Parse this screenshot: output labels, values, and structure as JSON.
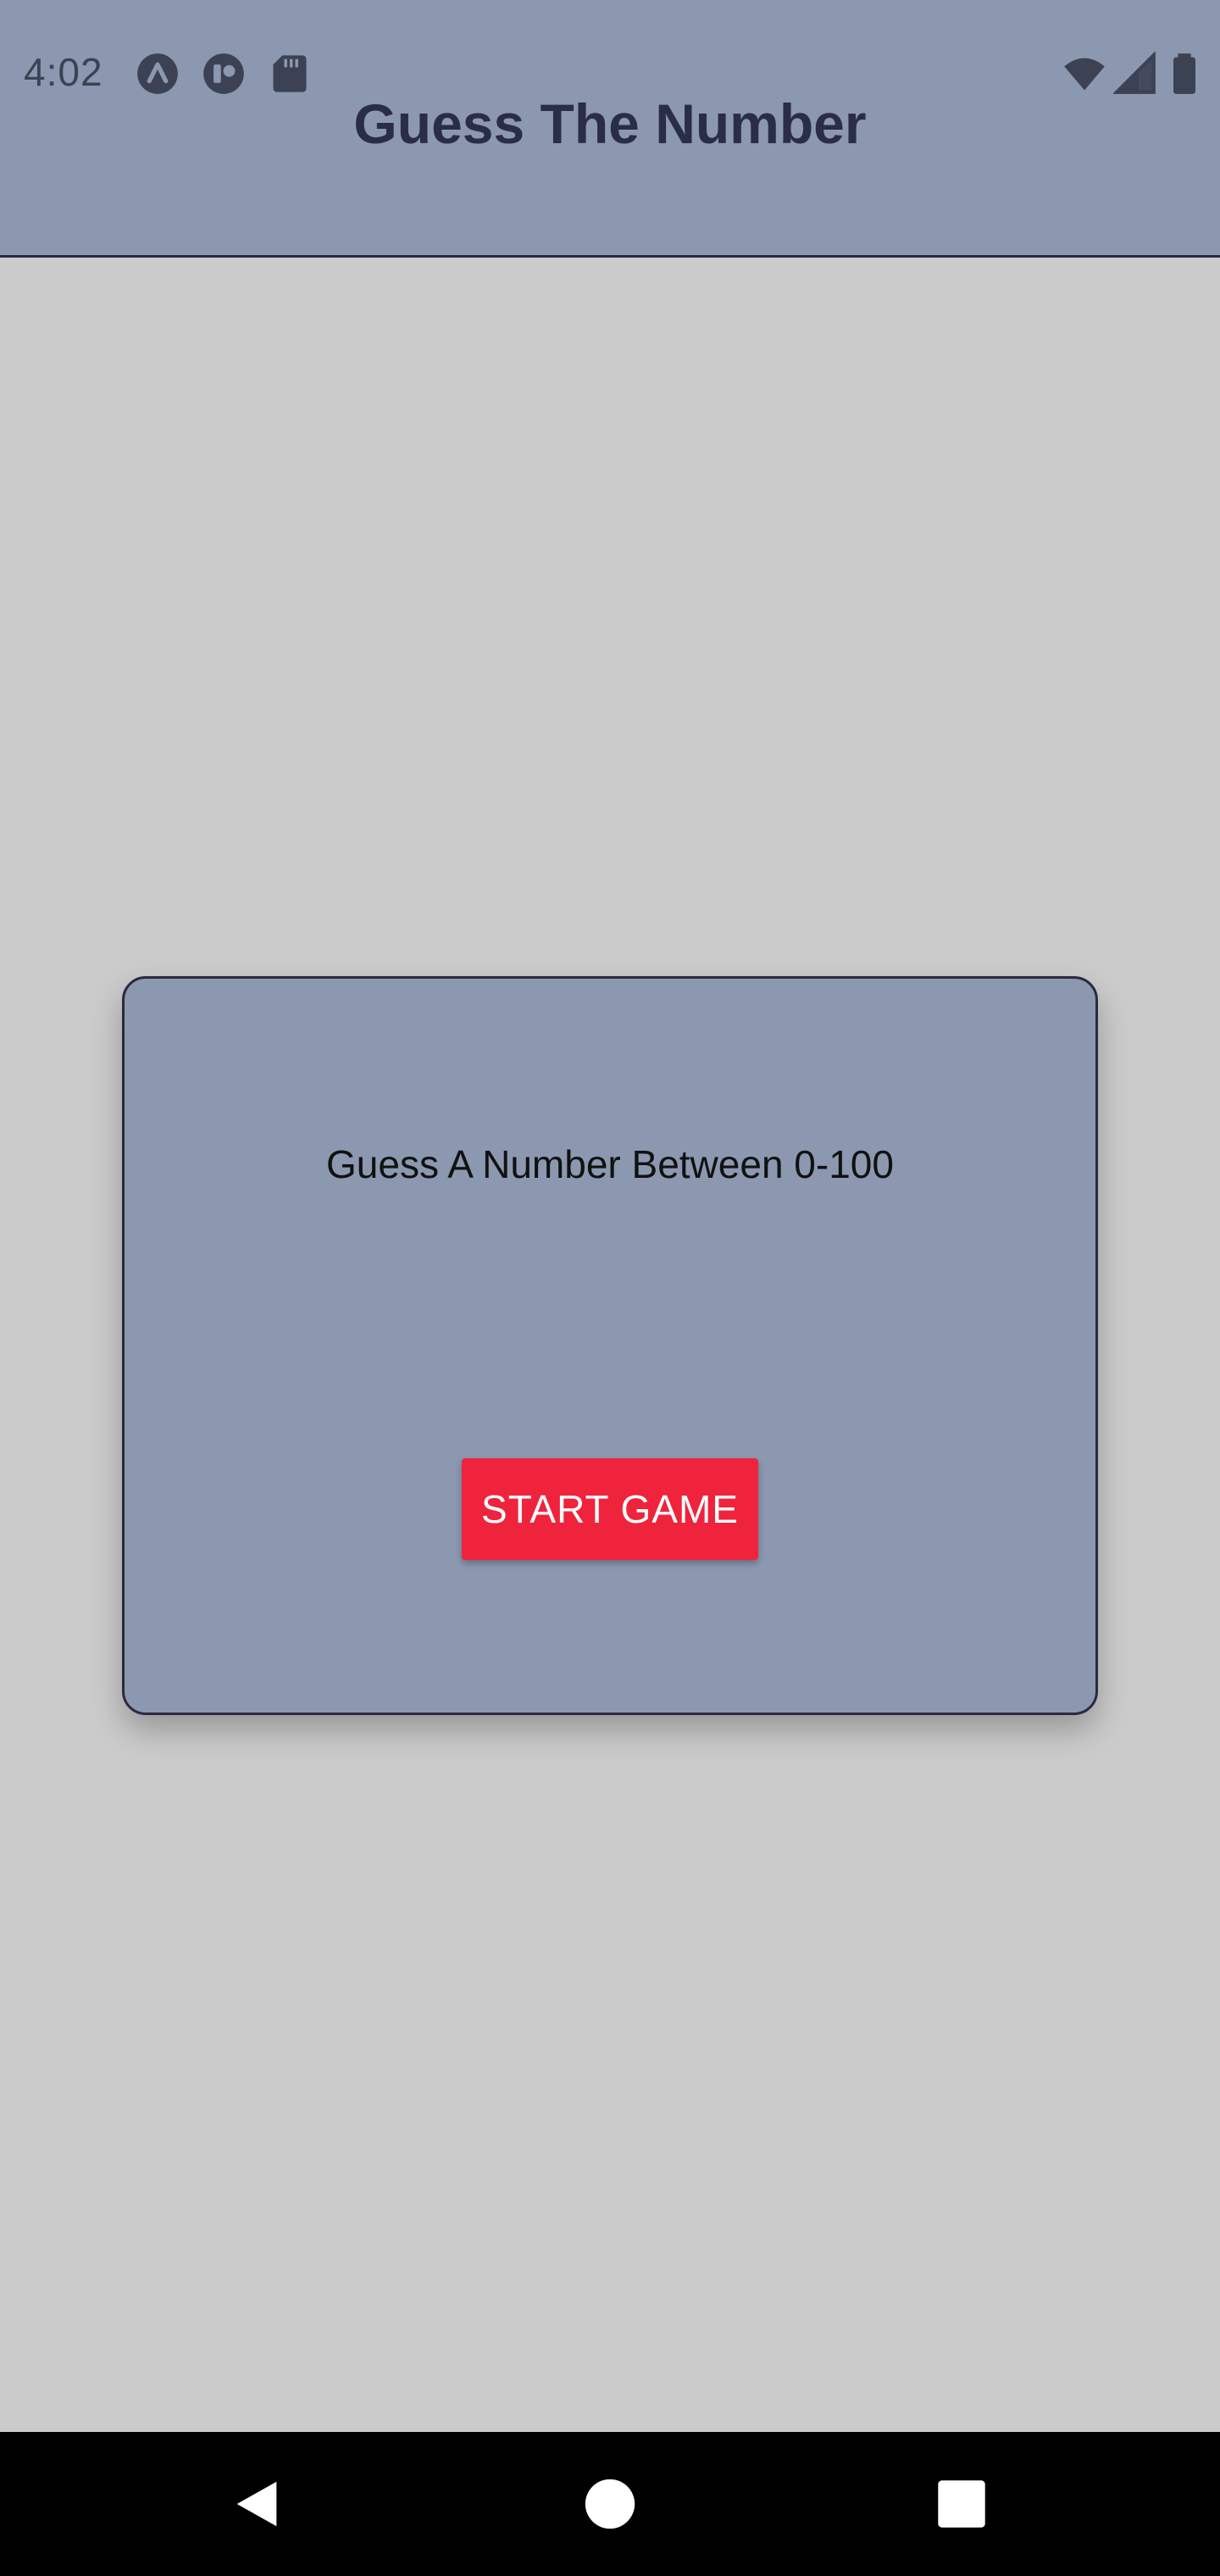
{
  "status_bar": {
    "time": "4:02",
    "left_icons": [
      "app-notification-icon",
      "app-notification-icon",
      "sd-card-icon"
    ],
    "right_icons": [
      "wifi-icon",
      "cell-signal-icon",
      "battery-icon"
    ]
  },
  "header": {
    "title": "Guess The Number",
    "background": "#8b98b0",
    "title_color": "#2a2d45"
  },
  "card": {
    "prompt": "Guess A Number Between 0-100",
    "input": {
      "value": "",
      "placeholder": ""
    },
    "start_button_label": "START GAME",
    "button_color": "#ef233c"
  },
  "nav_bar": {
    "buttons": [
      "back-icon",
      "home-icon",
      "recents-icon"
    ]
  },
  "colors": {
    "background": "#cbcbcb",
    "card": "#8b98b0",
    "accent": "#ef233c"
  }
}
